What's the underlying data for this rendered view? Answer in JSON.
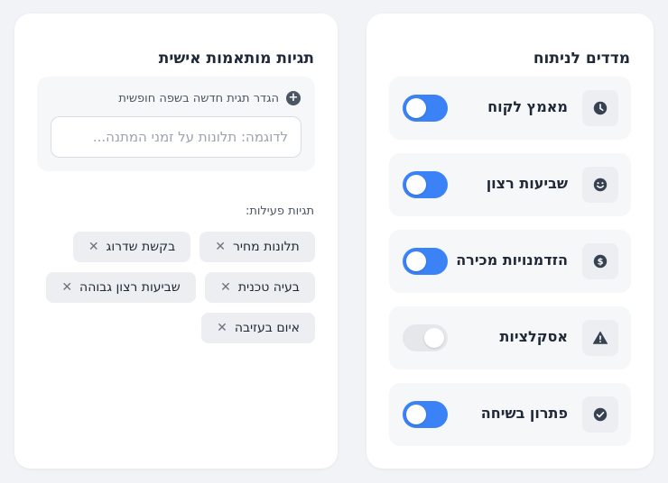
{
  "metrics_panel": {
    "title": "מדדים לניתוח",
    "items": [
      {
        "label": "מאמץ לקוח",
        "icon": "clock-icon",
        "enabled": true
      },
      {
        "label": "שביעות רצון",
        "icon": "smiley-icon",
        "enabled": true
      },
      {
        "label": "הזדמנויות מכירה",
        "icon": "dollar-icon",
        "enabled": true
      },
      {
        "label": "אסקלציות",
        "icon": "warning-icon",
        "enabled": false
      },
      {
        "label": "פתרון בשיחה",
        "icon": "check-circle-icon",
        "enabled": true
      }
    ]
  },
  "tags_panel": {
    "title": "תגיות מותאמות אישית",
    "new_tag_label": "הגדר תגית חדשה בשפה חופשית",
    "input_placeholder": "לדוגמה: תלונות על זמני המתנה...",
    "input_value": "",
    "active_tags_title": "תגיות פעילות:",
    "active_tags": [
      "תלונות מחיר",
      "בקשת שדרוג",
      "בעיה טכנית",
      "שביעות רצון גבוהה",
      "איום בעזיבה"
    ]
  },
  "colors": {
    "accent": "#3b82f6",
    "toggle_off": "#e5e7eb",
    "panel_bg": "#ffffff",
    "page_bg": "#f1f3f6"
  }
}
